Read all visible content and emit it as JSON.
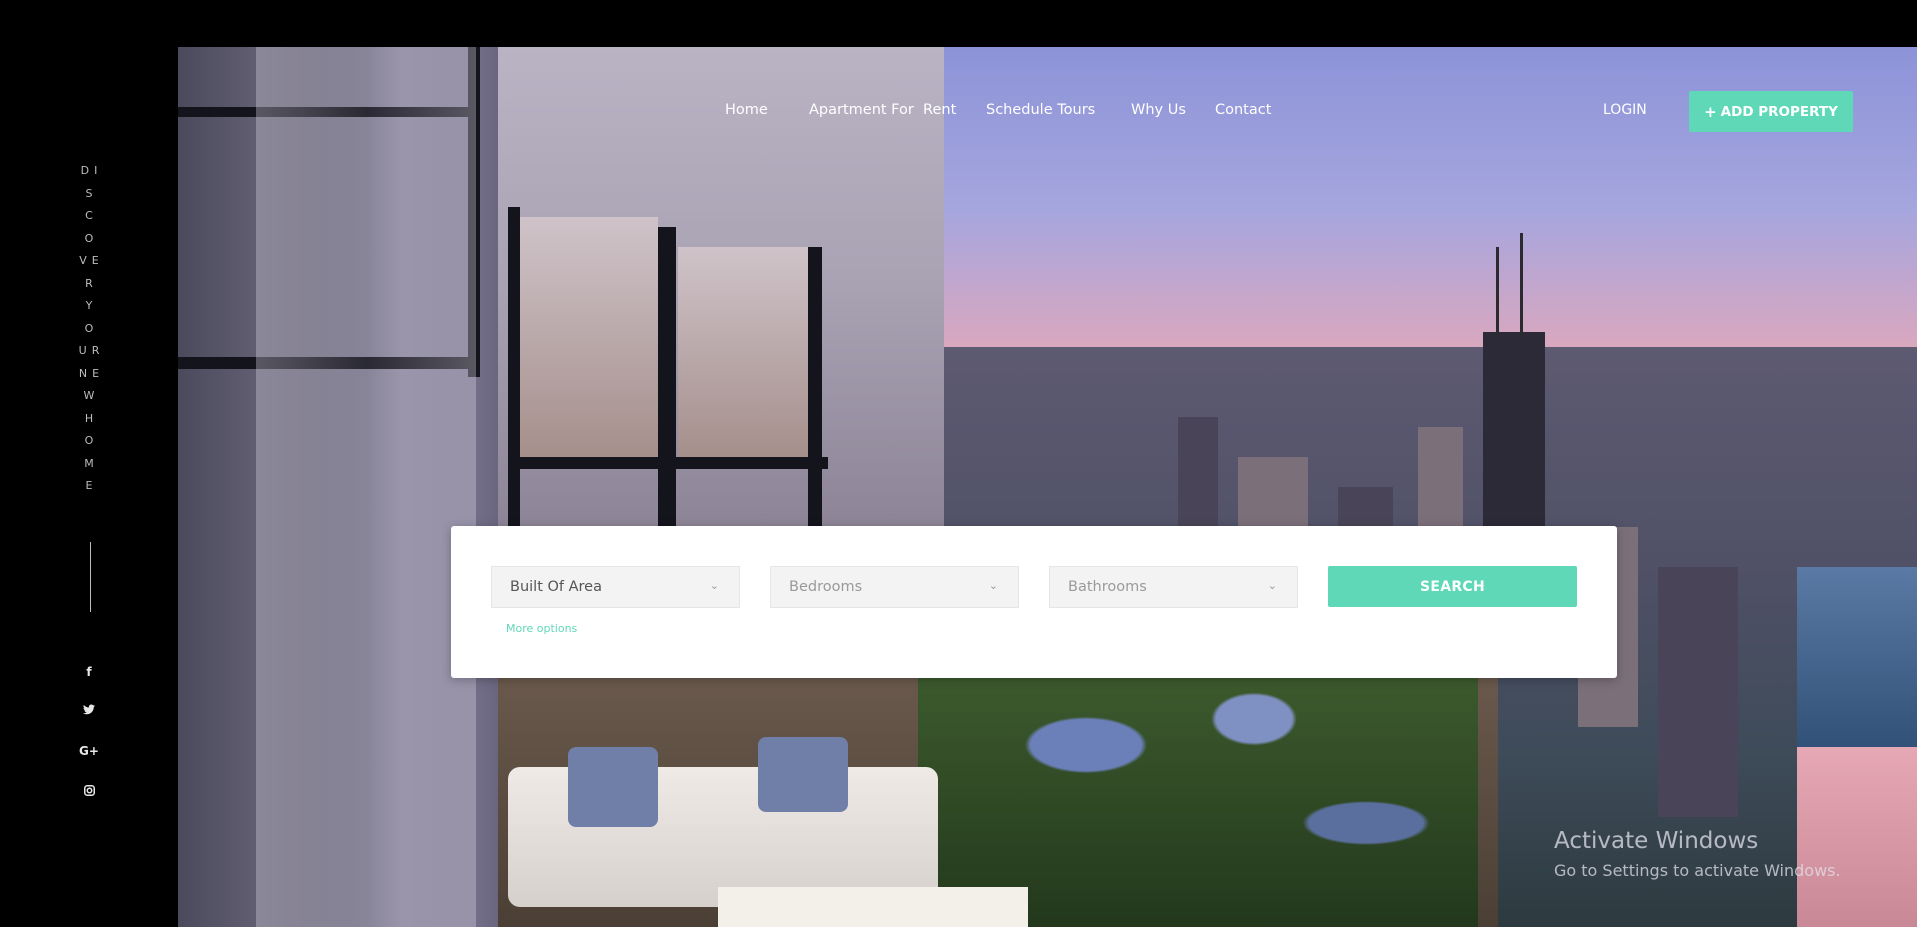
{
  "sidebar": {
    "tagline_lines": [
      "DI",
      "S",
      "C",
      "O",
      "VE",
      "R",
      "Y",
      "O",
      "UR",
      "NE",
      "W",
      "H",
      "O",
      "M",
      "E"
    ],
    "social_icons": [
      {
        "name": "facebook-icon",
        "glyph": "f"
      },
      {
        "name": "twitter-icon",
        "glyph": "🐦"
      },
      {
        "name": "google-plus-icon",
        "glyph": "G+"
      },
      {
        "name": "instagram-icon",
        "glyph": "◙"
      }
    ]
  },
  "nav": {
    "items": [
      {
        "label": "Home"
      },
      {
        "label": "Apartment For  Rent"
      },
      {
        "label": "Schedule Tours"
      },
      {
        "label": "Why Us"
      },
      {
        "label": "Contact"
      }
    ],
    "login_label": "LOGIN",
    "add_property_label": "ADD PROPERTY",
    "add_property_icon": "plus-icon"
  },
  "search": {
    "area_select": "Built Of Area",
    "bedrooms_select": "Bedrooms",
    "bathrooms_select": "Bathrooms",
    "search_label": "SEARCH",
    "more_options_label": "More options"
  },
  "watermark": {
    "title": "Activate Windows",
    "subtitle": "Go to Settings to activate Windows."
  },
  "colors": {
    "accent": "#5fd8b8",
    "sidebar_bg": "#000000"
  }
}
